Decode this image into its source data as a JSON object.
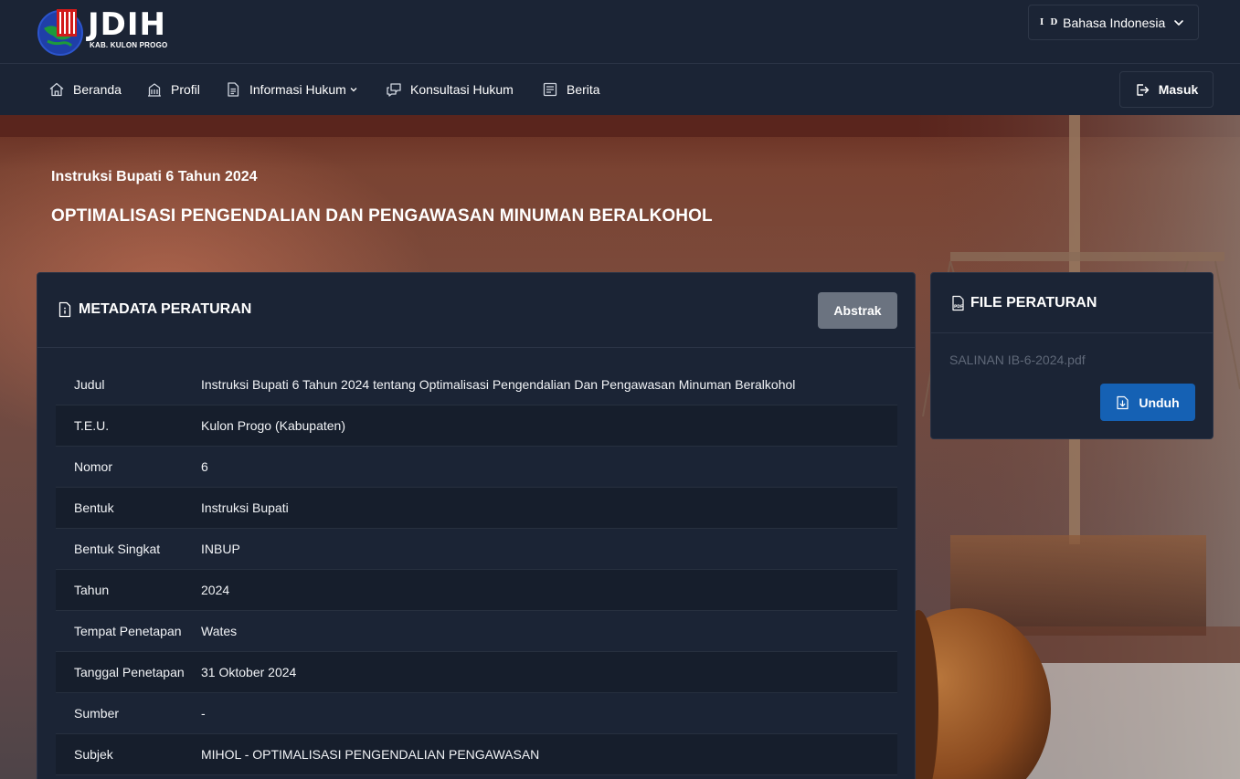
{
  "header": {
    "logo_text": "JDIH",
    "logo_subtitle": "KAB. KULON PROGO",
    "language": {
      "flag_code": "I D",
      "label": "Bahasa Indonesia"
    }
  },
  "nav": {
    "items": [
      {
        "label": "Beranda",
        "icon": "home-icon"
      },
      {
        "label": "Profil",
        "icon": "building-icon"
      },
      {
        "label": "Informasi Hukum",
        "icon": "document-icon"
      },
      {
        "label": "Konsultasi Hukum",
        "icon": "chat-icon"
      },
      {
        "label": "Berita",
        "icon": "newspaper-icon"
      }
    ],
    "login_label": "Masuk"
  },
  "document": {
    "kicker": "Instruksi Bupati 6 Tahun 2024",
    "title": "OPTIMALISASI PENGENDALIAN DAN PENGAWASAN MINUMAN BERALKOHOL"
  },
  "metadata": {
    "heading": "METADATA PERATURAN",
    "abstrak_label": "Abstrak",
    "rows": [
      {
        "key": "Judul",
        "value": "Instruksi Bupati 6 Tahun 2024 tentang Optimalisasi Pengendalian Dan Pengawasan Minuman Beralkohol"
      },
      {
        "key": "T.E.U.",
        "value": "Kulon Progo (Kabupaten)"
      },
      {
        "key": "Nomor",
        "value": "6"
      },
      {
        "key": "Bentuk",
        "value": "Instruksi Bupati"
      },
      {
        "key": "Bentuk Singkat",
        "value": "INBUP"
      },
      {
        "key": "Tahun",
        "value": "2024"
      },
      {
        "key": "Tempat Penetapan",
        "value": "Wates"
      },
      {
        "key": "Tanggal Penetapan",
        "value": "31 Oktober 2024"
      },
      {
        "key": "Sumber",
        "value": "-"
      },
      {
        "key": "Subjek",
        "value": "MIHOL - OPTIMALISASI PENGENDALIAN PENGAWASAN"
      }
    ]
  },
  "file": {
    "heading": "FILE PERATURAN",
    "filename": "SALINAN IB-6-2024.pdf",
    "download_label": "Unduh"
  },
  "colors": {
    "panel": "#1b2435",
    "download_button": "#1561b4",
    "abstrak_button": "#6b7380"
  }
}
